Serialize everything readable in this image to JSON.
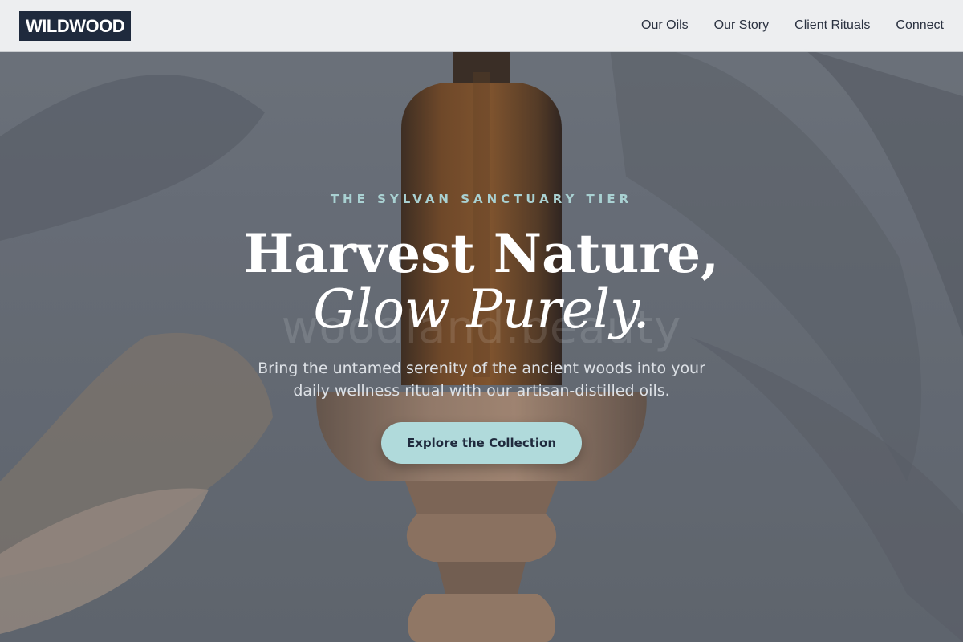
{
  "brand": {
    "logo_text": "WILDWOOD"
  },
  "nav": {
    "items": [
      {
        "label": "Our Oils"
      },
      {
        "label": "Our Story"
      },
      {
        "label": "Client Rituals"
      },
      {
        "label": "Connect"
      }
    ]
  },
  "hero": {
    "eyebrow": "THE SYLVAN SANCTUARY TIER",
    "headline_line1": "Harvest Nature,",
    "headline_line2": "Glow Purely.",
    "watermark": "woodland.beauty",
    "subtitle": "Bring the untamed serenity of the ancient woods into your daily wellness ritual with our artisan-distilled oils.",
    "cta_label": "Explore the Collection"
  },
  "colors": {
    "logo_bg": "#1f2a3d",
    "accent": "#b0dadb",
    "eyebrow": "#a9d1d2",
    "header_bg": "#f3f4f5"
  }
}
